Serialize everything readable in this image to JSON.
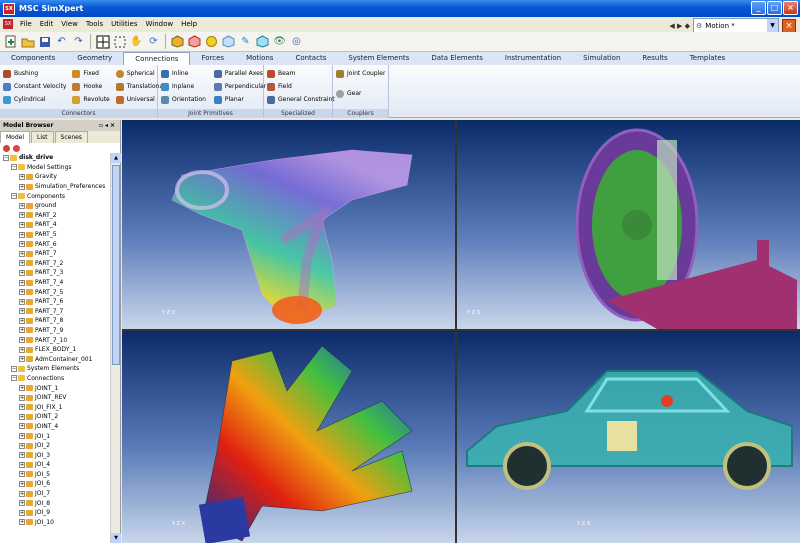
{
  "window": {
    "title": "MSC SimXpert",
    "app_icon": "SX"
  },
  "menu": [
    "File",
    "Edit",
    "View",
    "Tools",
    "Utilities",
    "Window",
    "Help"
  ],
  "motion_selector": {
    "value": "Motion *"
  },
  "toolbar_icons": [
    "new-file-icon",
    "open-folder-icon",
    "save-icon",
    "undo-icon",
    "redo-icon",
    "select-icon",
    "box-select-icon",
    "pan-hand-icon",
    "rotate-icon",
    "shaded-cube-icon",
    "wireframe-cube-icon",
    "sphere-icon",
    "transparent-icon",
    "pen-icon",
    "view-icon",
    "eye-icon",
    "glasses-icon"
  ],
  "ribbon_tabs": [
    "Components",
    "Geometry",
    "Connections",
    "Forces",
    "Motions",
    "Contacts",
    "System Elements",
    "Data Elements",
    "Instrumentation",
    "Simulation",
    "Results",
    "Templates"
  ],
  "active_tab": "Connections",
  "groups": {
    "connectors": {
      "label": "Connectors",
      "col1": [
        "Bushing",
        "Constant Velocity",
        "Cylindrical"
      ],
      "col2": [
        "Fixed",
        "Hooke",
        "Revolute"
      ],
      "col3": [
        "Spherical",
        "Translational",
        "Universal"
      ]
    },
    "joint_primitives": {
      "label": "Joint Primitives",
      "col1": [
        "Inline",
        "Inplane",
        "Orientation"
      ],
      "col2": [
        "Parallel Axes",
        "Perpendicular",
        "Planar"
      ]
    },
    "specialized": {
      "label": "Specialized",
      "items": [
        "Beam",
        "Field",
        "General Constraint"
      ]
    },
    "couplers": {
      "label": "Couplers",
      "items": [
        "Joint Coupler",
        "Gear"
      ]
    }
  },
  "browser": {
    "title": "Model Browser",
    "tabs": [
      "Model",
      "List",
      "Scenes"
    ],
    "tree": [
      {
        "t": "disk_drive",
        "lvl": 0
      },
      {
        "t": "Model Settings",
        "lvl": 1
      },
      {
        "t": "Gravity",
        "lvl": 2
      },
      {
        "t": "Simulation_Preferences",
        "lvl": 2
      },
      {
        "t": "Components",
        "lvl": 1
      },
      {
        "t": "ground",
        "lvl": 2
      },
      {
        "t": "PART_2",
        "lvl": 2
      },
      {
        "t": "PART_4",
        "lvl": 2
      },
      {
        "t": "PART_5",
        "lvl": 2
      },
      {
        "t": "PART_6",
        "lvl": 2
      },
      {
        "t": "PART_7",
        "lvl": 2
      },
      {
        "t": "PART_7_2",
        "lvl": 2
      },
      {
        "t": "PART_7_3",
        "lvl": 2
      },
      {
        "t": "PART_7_4",
        "lvl": 2
      },
      {
        "t": "PART_7_5",
        "lvl": 2
      },
      {
        "t": "PART_7_6",
        "lvl": 2
      },
      {
        "t": "PART_7_7",
        "lvl": 2
      },
      {
        "t": "PART_7_8",
        "lvl": 2
      },
      {
        "t": "PART_7_9",
        "lvl": 2
      },
      {
        "t": "PART_7_10",
        "lvl": 2
      },
      {
        "t": "FLEX_BODY_1",
        "lvl": 2
      },
      {
        "t": "AdmContainer_001",
        "lvl": 2
      },
      {
        "t": "System Elements",
        "lvl": 1
      },
      {
        "t": "Connections",
        "lvl": 1
      },
      {
        "t": "JOINT_1",
        "lvl": 2
      },
      {
        "t": "JOINT_REV",
        "lvl": 2
      },
      {
        "t": "JOI_FIX_1",
        "lvl": 2
      },
      {
        "t": "JOINT_2",
        "lvl": 2
      },
      {
        "t": "JOINT_4",
        "lvl": 2
      },
      {
        "t": "JOI_1",
        "lvl": 2
      },
      {
        "t": "JOI_2",
        "lvl": 2
      },
      {
        "t": "JOI_3",
        "lvl": 2
      },
      {
        "t": "JOI_4",
        "lvl": 2
      },
      {
        "t": "JOI_5",
        "lvl": 2
      },
      {
        "t": "JOI_6",
        "lvl": 2
      },
      {
        "t": "JOI_7",
        "lvl": 2
      },
      {
        "t": "JOI_8",
        "lvl": 2
      },
      {
        "t": "JOI_9",
        "lvl": 2
      },
      {
        "t": "JOI_10",
        "lvl": 2
      }
    ]
  },
  "axis_labels": {
    "x": "X",
    "y": "Y",
    "z": "Z"
  }
}
